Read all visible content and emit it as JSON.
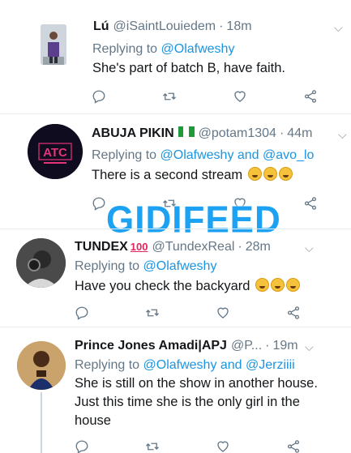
{
  "tweets": [
    {
      "name": "Lú",
      "handle": "@iSaintLouiedem",
      "time": "18m",
      "replying_prefix": "Replying to",
      "mentions": "@Olafweshy",
      "body": "She's part of batch B, have faith."
    },
    {
      "name": "ABUJA PIKIN",
      "handle": "@potam1304",
      "time": "44m",
      "replying_prefix": "Replying to",
      "mentions": "@Olafweshy and @avo_lo",
      "body": "There is a second stream",
      "avatar_text": "ATC"
    },
    {
      "name": "TUNDEX",
      "name_badge": "100",
      "handle": "@TundexReal",
      "time": "28m",
      "replying_prefix": "Replying to",
      "mentions": "@Olafweshy",
      "body": "Have you check the backyard"
    },
    {
      "name": "Prince Jones Amadi|APJ",
      "handle": "@P...",
      "time": "19m",
      "replying_prefix": "Replying to",
      "mentions": "@Olafweshy and @Jerziiii",
      "body_lines": [
        "She is still on the show in another house.",
        "Just this time she is the only girl in the",
        "house"
      ]
    }
  ],
  "watermark": "GIDIFEED",
  "icons": [
    "reply-icon",
    "retweet-icon",
    "like-icon",
    "share-icon",
    "chevron-down-icon"
  ],
  "colors": {
    "link": "#1b95e0",
    "muted": "#657786",
    "watermark": "#1da1f2"
  }
}
